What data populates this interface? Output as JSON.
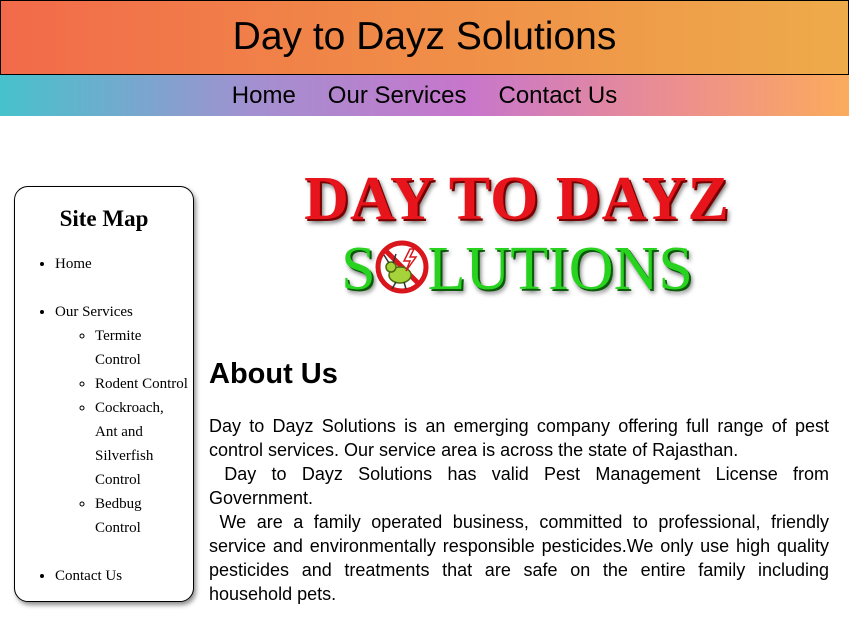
{
  "header": {
    "title": "Day to Dayz Solutions"
  },
  "nav": {
    "items": [
      {
        "label": "Home"
      },
      {
        "label": "Our Services"
      },
      {
        "label": "Contact Us"
      }
    ]
  },
  "sitemap": {
    "title": "Site Map",
    "home": "Home",
    "services": "Our Services",
    "service_items": [
      {
        "label": "Termite Control"
      },
      {
        "label": "Rodent Control"
      },
      {
        "label": "Cockroach, Ant and Silverfish Control"
      },
      {
        "label": "Bedbug Control"
      }
    ],
    "contact": "Contact Us"
  },
  "logo": {
    "line1": "DAY TO DAYZ",
    "line2_prefix": "S",
    "line2_suffix": "LUTIONS",
    "badge_icon": "pest-no-bug-icon"
  },
  "about": {
    "heading": "About Us",
    "paragraphs": [
      "Day to Dayz Solutions is an emerging company offering full range of pest control services. Our service area is across the state of Rajasthan.",
      " Day to Dayz Solutions has valid Pest Management License from Government.",
      " We are a family operated business, committed to professional, friendly service and environmentally responsible pesticides.We only use high quality pesticides and treatments that are safe on the entire family including household pets."
    ]
  },
  "colors": {
    "header_gradient_start": "#f26a4a",
    "header_gradient_end": "#eeab4a",
    "nav_gradient_start": "#46c2cb",
    "nav_gradient_mid": "#c776cc",
    "nav_gradient_end": "#fbab5c",
    "logo_red": "#e8141b",
    "logo_green": "#27d31f"
  }
}
